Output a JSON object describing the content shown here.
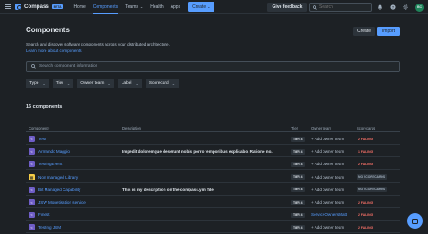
{
  "nav": {
    "brand": "Compass",
    "beta": "BETA",
    "links": [
      {
        "label": "Home"
      },
      {
        "label": "Components"
      },
      {
        "label": "Teams"
      },
      {
        "label": "Health"
      },
      {
        "label": "Apps"
      }
    ],
    "create": "Create",
    "feedback": "Give feedback",
    "search_placeholder": "Search",
    "avatar": "BC"
  },
  "header": {
    "title": "Components",
    "create_button": "Create",
    "import_button": "Import",
    "description": "Search and discover software components across your distributed architecture.",
    "learn_more": "Learn more about components"
  },
  "search": {
    "placeholder": "Search component information"
  },
  "filters": [
    "Type",
    "Tier",
    "Owner team",
    "Label",
    "Scorecard"
  ],
  "count": "16 components",
  "table": {
    "headers": {
      "component": "Component↑",
      "description": "Description",
      "tier": "Tier",
      "owner": "Owner team",
      "scorecards": "Scorecards"
    },
    "rows": [
      {
        "name": "Test",
        "description": "",
        "tier": "TIER 4",
        "owner": "+ Add owner team",
        "score": "2 FAILING",
        "score_type": "fail",
        "icon": "service-icon"
      },
      {
        "name": "Armando Maggio",
        "description": "Impedit doloremque deserunt nobis porro temporibus explicabo. Ratione no...",
        "tier": "TIER 4",
        "owner": "+ Add owner team",
        "score": "1 FAILING",
        "score_type": "fail",
        "icon": "service-icon"
      },
      {
        "name": "TestingEvent",
        "description": "",
        "tier": "TIER 4",
        "owner": "+ Add owner team",
        "score": "2 FAILING",
        "score_type": "fail",
        "icon": "service-icon"
      },
      {
        "name": "Non managed Library",
        "description": "",
        "tier": "TIER 4",
        "owner": "+ Add owner team",
        "score": "NO SCORECARDS",
        "score_type": "none",
        "icon": "library-icon"
      },
      {
        "name": "Bit Managed Capability",
        "description": "This is my description on the compass.yml file.",
        "tier": "TIER 4",
        "owner": "+ Add owner team",
        "score": "NO SCORECARDS",
        "score_type": "none",
        "icon": "capability-icon"
      },
      {
        "name": "JSW Monetisation service",
        "description": "",
        "tier": "TIER 4",
        "owner": "+ Add owner team",
        "score": "2 FAILING",
        "score_type": "fail",
        "icon": "service-icon"
      },
      {
        "name": "Finest",
        "description": "",
        "tier": "TIER 4",
        "owner": "ServiceOwnersMatt",
        "owner_linked": true,
        "score": "2 FAILING",
        "score_type": "fail",
        "icon": "service-icon"
      },
      {
        "name": "Testing JSM",
        "description": "",
        "tier": "TIER 4",
        "owner": "+ Add owner team",
        "score": "2 FAILING",
        "score_type": "fail",
        "icon": "service-icon"
      }
    ]
  },
  "colors": {
    "accent": "#579dff",
    "background": "#1d2125",
    "failing": "#f87168"
  }
}
